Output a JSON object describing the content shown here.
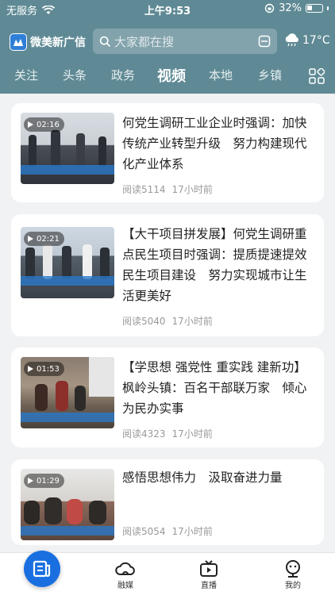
{
  "status_bar": {
    "carrier": "无服务",
    "time": "上午9:53",
    "battery": "32%"
  },
  "header": {
    "logo_text": "微美新广信",
    "search_placeholder": "大家都在搜",
    "weather_temp": "17°C"
  },
  "tabs": [
    {
      "label": "关注"
    },
    {
      "label": "头条"
    },
    {
      "label": "政务"
    },
    {
      "label": "视频",
      "active": true
    },
    {
      "label": "本地"
    },
    {
      "label": "乡镇"
    }
  ],
  "videos": [
    {
      "duration": "02:16",
      "title": "何党生调研工业企业时强调：加快传统产业转型升级　努力构建现代化产业体系",
      "reads": "阅读5114",
      "time": "17小时前"
    },
    {
      "duration": "02:21",
      "title": "【大干项目拼发展】何党生调研重点民生项目时强调：提质提速提效民生项目建设　努力实现城市让生活更美好",
      "reads": "阅读5040",
      "time": "17小时前"
    },
    {
      "duration": "01:53",
      "title": "【学思想 强党性 重实践 建新功】枫岭头镇：百名干部联万家　倾心为民办实事",
      "reads": "阅读4323",
      "time": "17小时前"
    },
    {
      "duration": "01:29",
      "title": "感悟思想伟力　汲取奋进力量",
      "reads": "阅读5054",
      "time": "17小时前"
    }
  ],
  "bottom_nav": [
    {
      "label": "",
      "icon": "home-icon"
    },
    {
      "label": "融媒",
      "icon": "cloud-icon"
    },
    {
      "label": "直播",
      "icon": "tv-icon"
    },
    {
      "label": "我的",
      "icon": "user-icon"
    }
  ],
  "colors": {
    "header_bg": "#5f8a95",
    "accent": "#1a6fe0"
  }
}
